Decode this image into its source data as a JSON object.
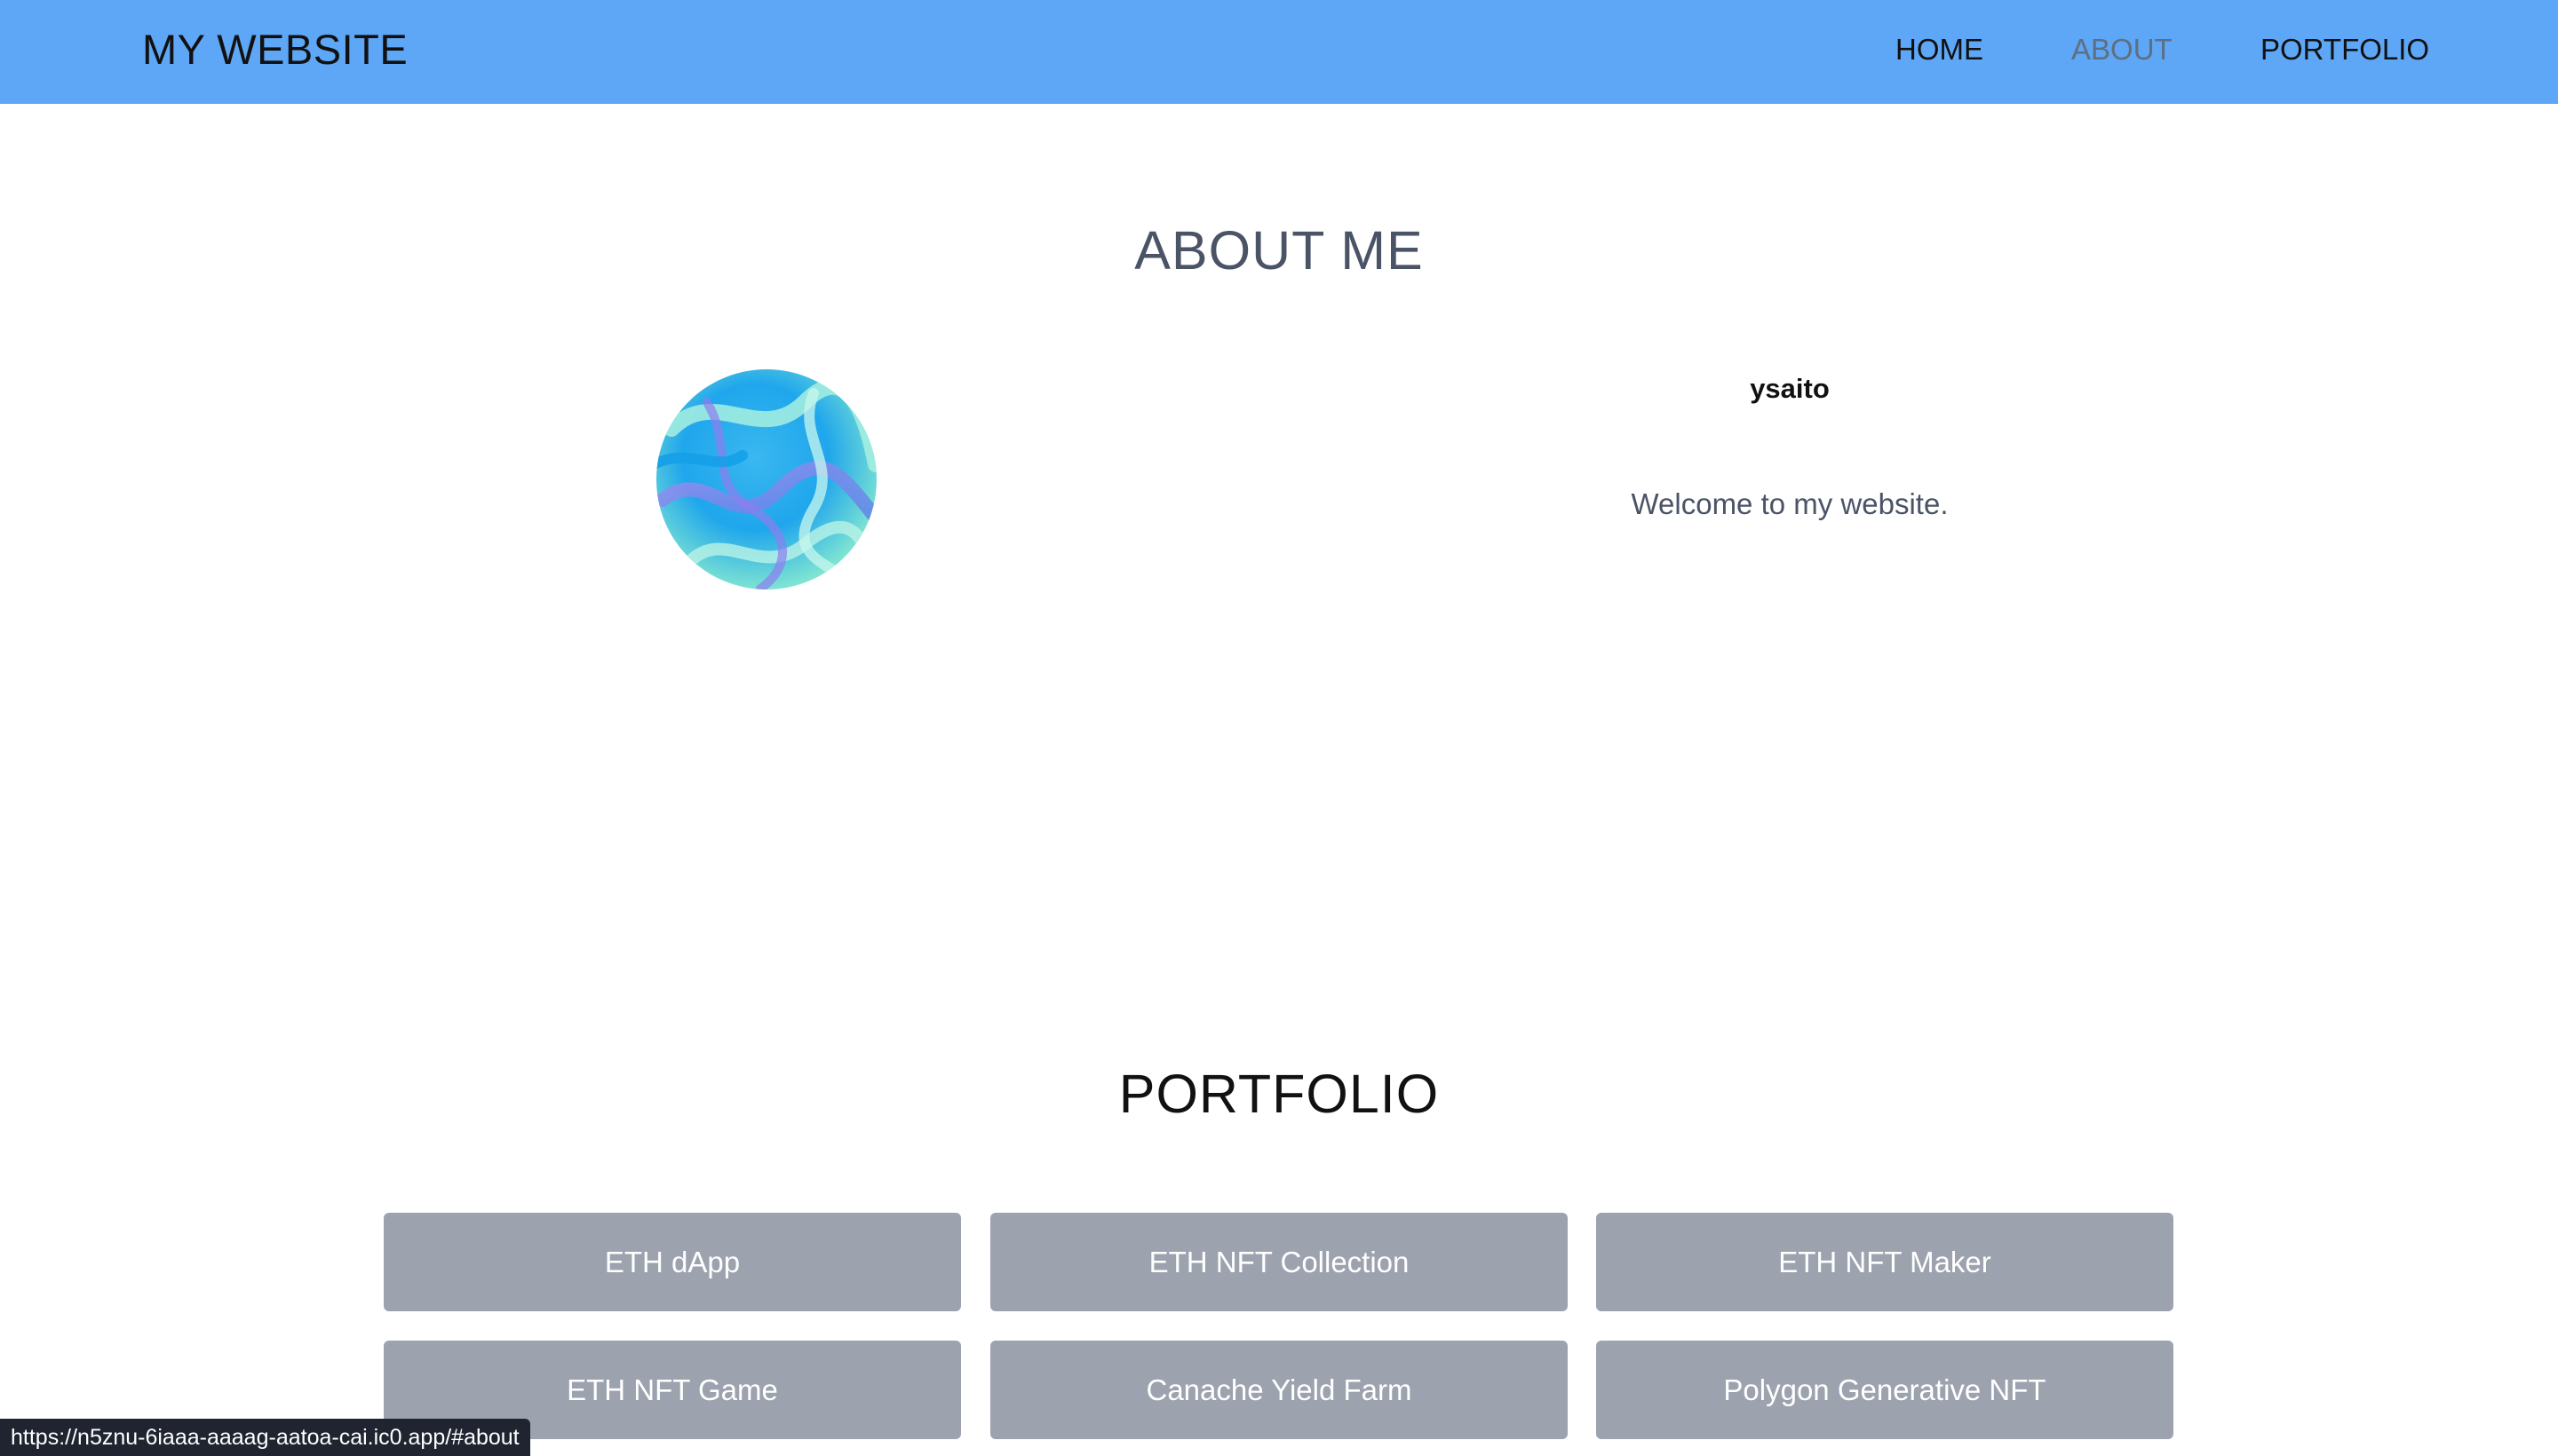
{
  "header": {
    "brand": "MY WEBSITE",
    "nav": [
      {
        "label": "HOME",
        "active": false
      },
      {
        "label": "ABOUT",
        "active": true
      },
      {
        "label": "PORTFOLIO",
        "active": false
      }
    ],
    "background_color": "#5ea6f6"
  },
  "about": {
    "heading": "ABOUT ME",
    "avatar_icon": "abstract-iridescent-sphere",
    "username": "ysaito",
    "description": "Welcome to my website."
  },
  "portfolio": {
    "heading": "PORTFOLIO",
    "items": [
      {
        "label": "ETH dApp"
      },
      {
        "label": "ETH NFT Collection"
      },
      {
        "label": "ETH NFT Maker"
      },
      {
        "label": "ETH NFT Game"
      },
      {
        "label": "Canache Yield Farm"
      },
      {
        "label": "Polygon Generative NFT"
      }
    ],
    "card_color": "#9ca3af"
  },
  "status_bar": {
    "url": "https://n5znu-6iaaa-aaaag-aatoa-cai.ic0.app/#about"
  }
}
